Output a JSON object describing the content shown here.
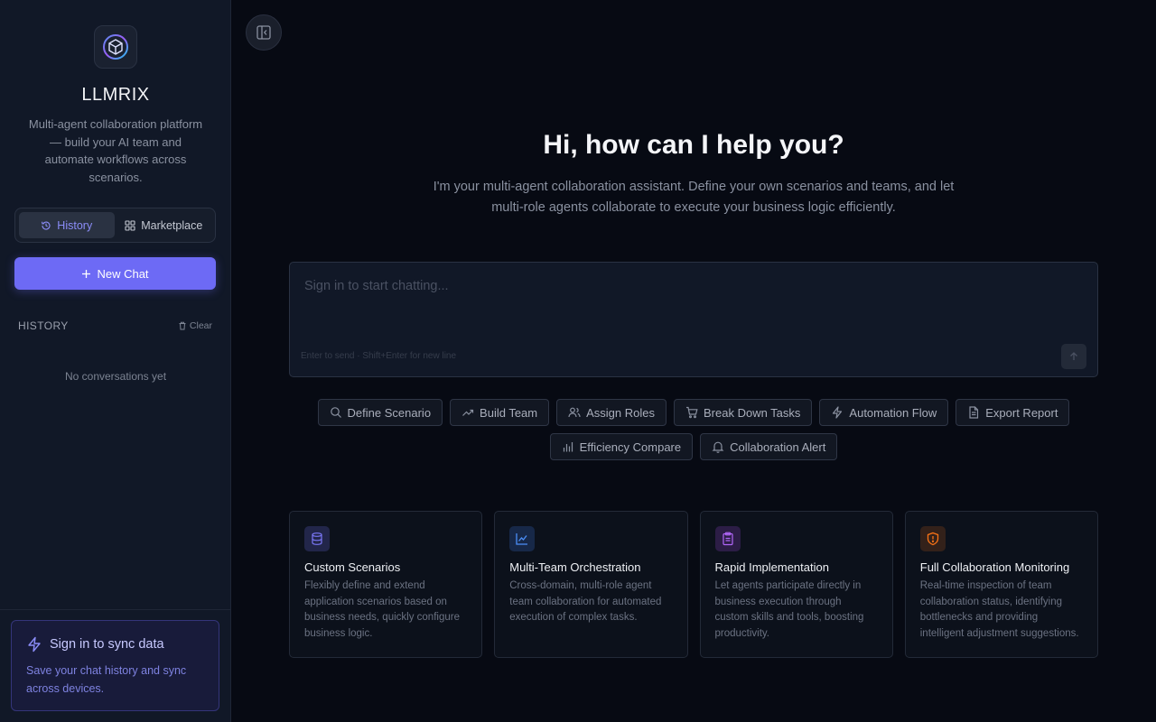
{
  "sidebar": {
    "app_name": "LLMRIX",
    "description": "Multi-agent collaboration platform — build your AI team and automate workflows across scenarios.",
    "tabs": [
      {
        "label": "History",
        "icon": "history-icon",
        "active": true
      },
      {
        "label": "Marketplace",
        "icon": "grid-icon",
        "active": false
      }
    ],
    "new_chat_label": "New Chat",
    "history_heading": "HISTORY",
    "clear_label": "Clear",
    "empty_text": "No conversations yet",
    "sync": {
      "title": "Sign in to sync data",
      "text": "Save your chat history and sync across devices."
    }
  },
  "main": {
    "title": "Hi, how can I help you?",
    "subtitle": "I'm your multi-agent collaboration assistant. Define your own scenarios and teams, and let multi-role agents collaborate to execute your business logic efficiently.",
    "input": {
      "placeholder": "Sign in to start chatting...",
      "value": "",
      "hint": "Enter to send · Shift+Enter for new line"
    },
    "chips": [
      {
        "label": "Define Scenario",
        "icon": "search-icon"
      },
      {
        "label": "Build Team",
        "icon": "trend-icon"
      },
      {
        "label": "Assign Roles",
        "icon": "users-icon"
      },
      {
        "label": "Break Down Tasks",
        "icon": "cart-icon"
      },
      {
        "label": "Automation Flow",
        "icon": "bolt-icon"
      },
      {
        "label": "Export Report",
        "icon": "file-icon"
      },
      {
        "label": "Efficiency Compare",
        "icon": "bar-chart-icon"
      },
      {
        "label": "Collaboration Alert",
        "icon": "bell-icon"
      }
    ],
    "cards": [
      {
        "title": "Custom Scenarios",
        "desc": "Flexibly define and extend application scenarios based on business needs, quickly configure business logic.",
        "icon": "database-icon",
        "color": "#6d6af5"
      },
      {
        "title": "Multi-Team Orchestration",
        "desc": "Cross-domain, multi-role agent team collaboration for automated execution of complex tasks.",
        "icon": "line-chart-icon",
        "color": "#3b82f6"
      },
      {
        "title": "Rapid Implementation",
        "desc": "Let agents participate directly in business execution through custom skills and tools, boosting productivity.",
        "icon": "clipboard-icon",
        "color": "#a855f7"
      },
      {
        "title": "Full Collaboration Monitoring",
        "desc": "Real-time inspection of team collaboration status, identifying bottlenecks and providing intelligent adjustment suggestions.",
        "icon": "shield-alert-icon",
        "color": "#f97316"
      }
    ]
  }
}
